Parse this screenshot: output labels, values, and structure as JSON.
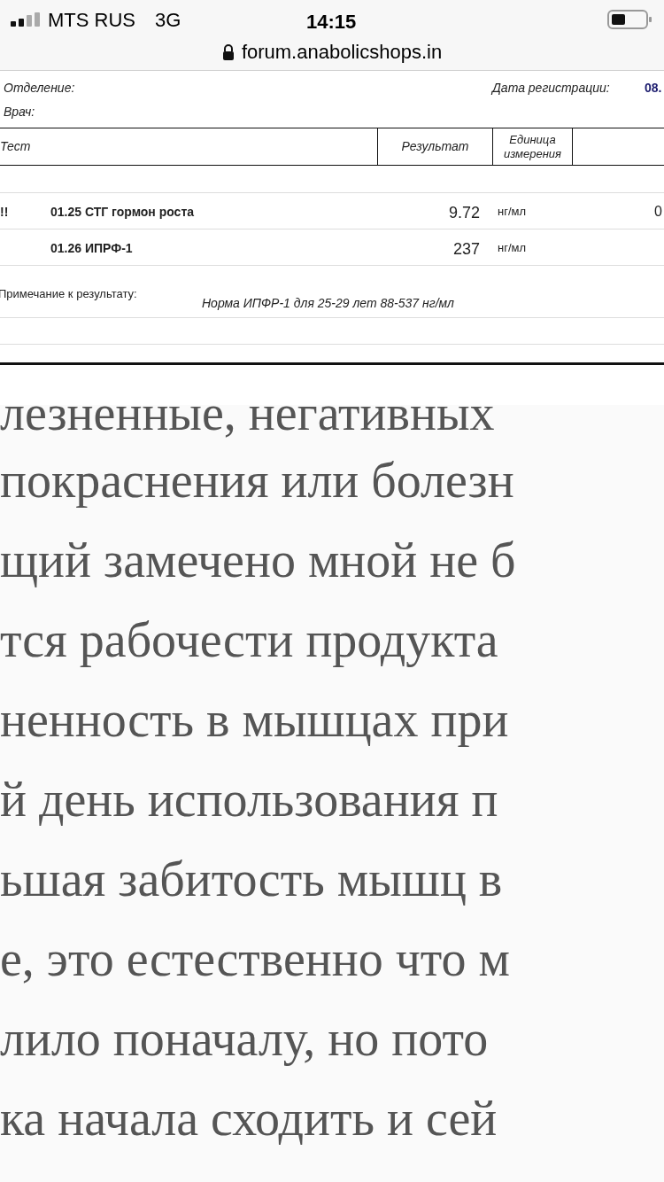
{
  "status_bar": {
    "carrier": "MTS RUS",
    "network": "3G",
    "time": "14:15"
  },
  "address_bar": {
    "url": "forum.anabolicshops.in"
  },
  "report": {
    "department_label": "Отделение:",
    "doctor_label": "Врач:",
    "registration_label": "Дата регистрации:",
    "registration_value": "08.",
    "columns": [
      "Тест",
      "Результат",
      "Единица измерения"
    ],
    "rows": [
      {
        "flag": "!!",
        "test": "01.25 СТГ гормон роста",
        "result": "9.72",
        "unit": "нг/мл",
        "column_5": "0"
      },
      {
        "flag": "",
        "test": "01.26 ИПРФ-1",
        "result": "237",
        "unit": "нг/мл",
        "column_5": ""
      }
    ],
    "note_label": "Примечание к результату:",
    "note": "Норма ИПФР-1 для 25-29 лет 88-537 нг/мл"
  },
  "article_lines": [
    "лезненные, негативных",
    "покраснения или болезн",
    "щий замечено мной не б",
    "тся рабочести продукта",
    "ненность в мышцах при",
    "й день использования п",
    "ьшая забитость мышц в",
    "е, это естественно что м",
    "лило поначалу, но пото",
    "ка начала сходить и сей"
  ]
}
